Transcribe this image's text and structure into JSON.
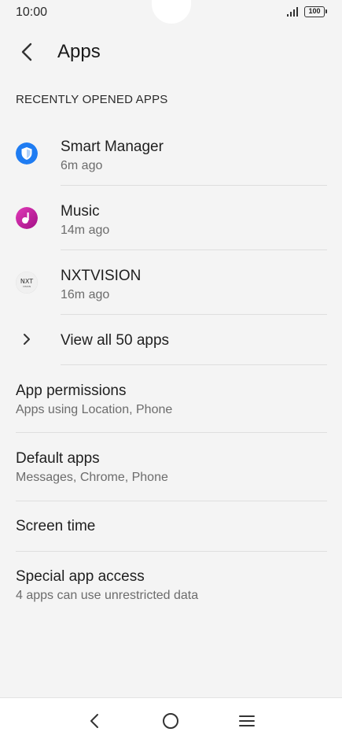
{
  "status_bar": {
    "time": "10:00",
    "battery": "100"
  },
  "header": {
    "title": "Apps"
  },
  "recent": {
    "section_label": "RECENTLY OPENED APPS",
    "apps": [
      {
        "name": "Smart Manager",
        "time": "6m ago",
        "icon": "smart-manager-icon"
      },
      {
        "name": "Music",
        "time": "14m ago",
        "icon": "music-icon"
      },
      {
        "name": "NXTVISION",
        "time": "16m ago",
        "icon": "nxtvision-icon"
      }
    ],
    "view_all_label": "View all 50 apps"
  },
  "settings": [
    {
      "title": "App permissions",
      "subtitle": "Apps using Location, Phone"
    },
    {
      "title": "Default apps",
      "subtitle": "Messages, Chrome, Phone"
    },
    {
      "title": "Screen time",
      "subtitle": ""
    },
    {
      "title": "Special app access",
      "subtitle": "4 apps can use unrestricted data"
    }
  ],
  "colors": {
    "smart_manager": "#1f7cf2",
    "music": "#c2189e",
    "background": "#f4f4f4"
  }
}
